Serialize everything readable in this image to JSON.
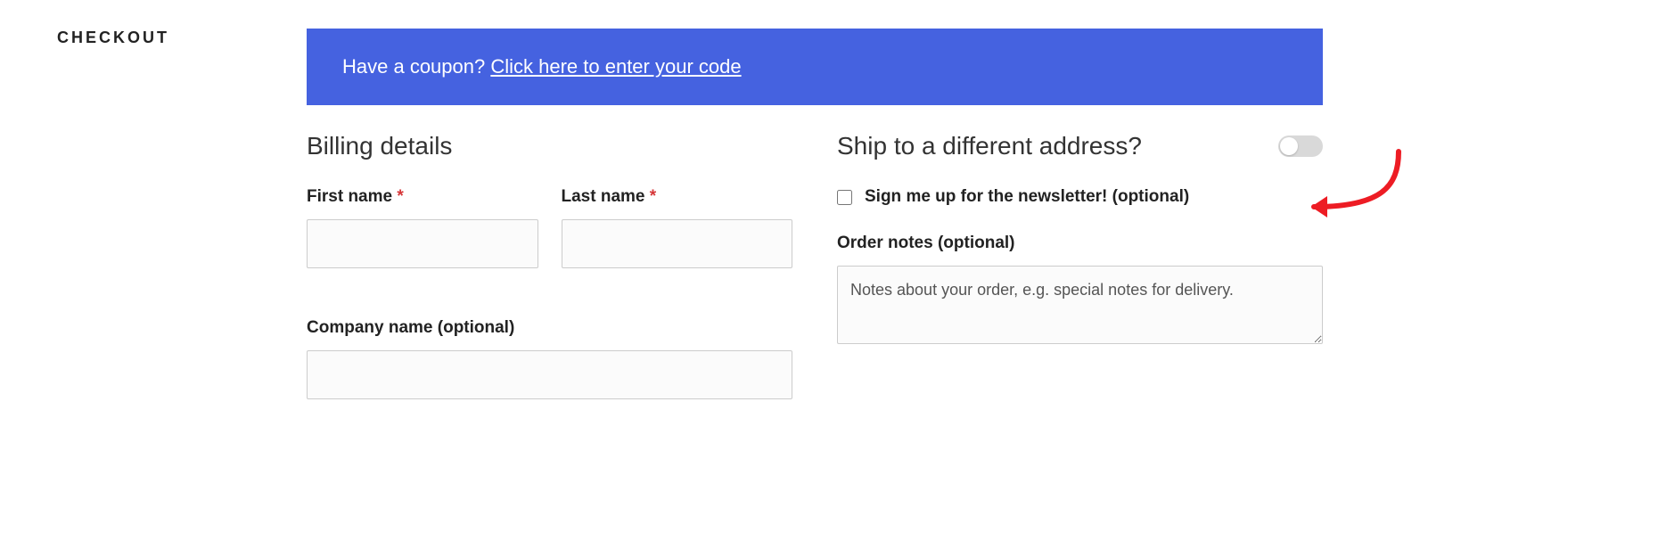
{
  "sidebar": {
    "title": "CHECKOUT"
  },
  "banner": {
    "prompt": "Have a coupon? ",
    "link": "Click here to enter your code"
  },
  "billing": {
    "heading": "Billing details",
    "first_name": {
      "label": "First name ",
      "value": ""
    },
    "last_name": {
      "label": "Last name ",
      "value": ""
    },
    "company": {
      "label": "Company name (optional)",
      "value": ""
    }
  },
  "shipping": {
    "heading": "Ship to a different address?",
    "newsletter_label": "Sign me up for the newsletter! (optional)",
    "order_notes_label": "Order notes (optional)",
    "order_notes_placeholder": "Notes about your order, e.g. special notes for delivery."
  },
  "required_mark": "*"
}
